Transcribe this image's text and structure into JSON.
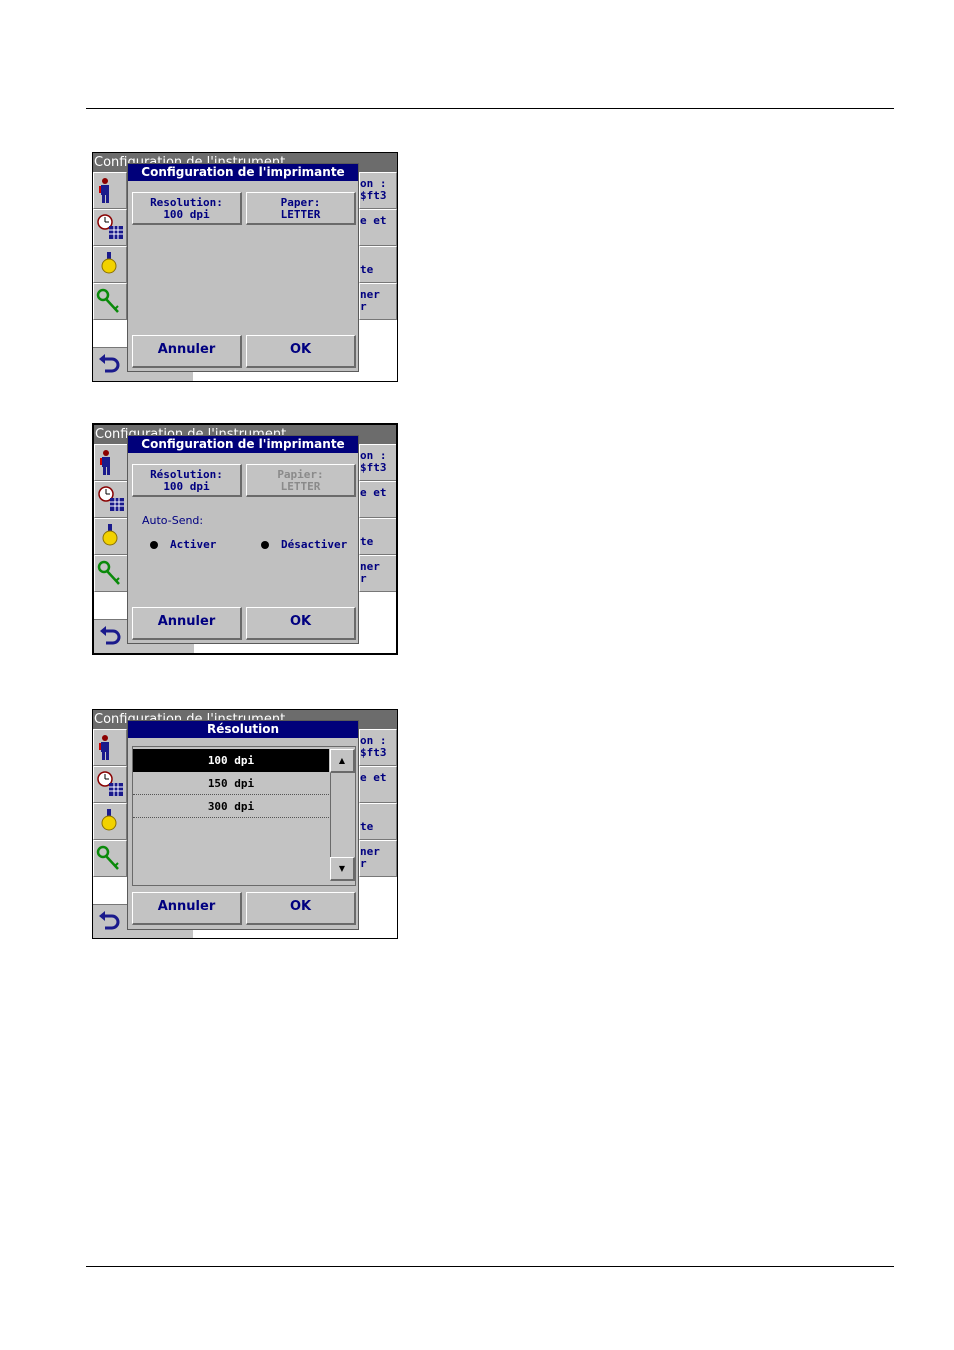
{
  "shared": {
    "background_title": "Configuration de l'instrument",
    "right_buttons": [
      {
        "text": "on :\n$ft3"
      },
      {
        "text": "e et"
      },
      {
        "text": "\nte"
      },
      {
        "text": "ner\nr"
      }
    ],
    "cancel_label": "Annuler",
    "ok_label": "OK"
  },
  "screen1": {
    "dialog_title": "Configuration de l'imprimante",
    "resolution": {
      "line1": "Resolution:",
      "line2": "100 dpi"
    },
    "paper": {
      "line1": "Paper:",
      "line2": "LETTER"
    }
  },
  "screen2": {
    "dialog_title": "Configuration de l'imprimante",
    "resolution": {
      "line1": "Résolution:",
      "line2": "100 dpi"
    },
    "paper": {
      "line1": "Papier:",
      "line2": "LETTER"
    },
    "autosend_label": "Auto-Send:",
    "activate": "Activer",
    "deactivate": "Désactiver"
  },
  "screen3": {
    "dialog_title": "Résolution",
    "options": [
      "100 dpi",
      "150 dpi",
      "300 dpi"
    ],
    "selected": "100 dpi",
    "scroll_up": "▲",
    "scroll_down": "▼"
  }
}
